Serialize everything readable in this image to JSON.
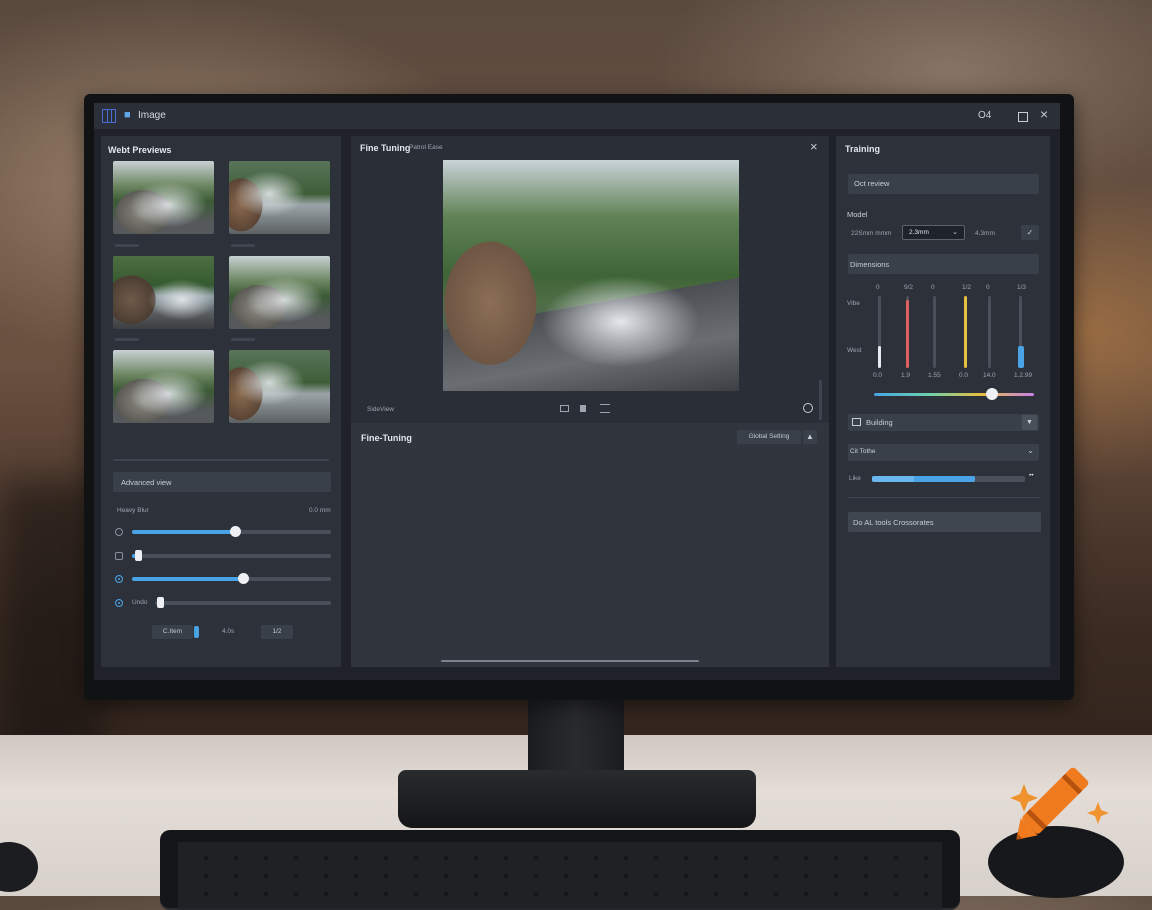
{
  "titlebar": {
    "app_title": "Image",
    "counter": "O4",
    "maximize_icon": "square-icon",
    "close_icon": "x-icon",
    "close_glyph": "×"
  },
  "left_panel": {
    "title": "Webt Previews",
    "section_label": "Advanced view",
    "slider_group_label": "Heavy Blur",
    "slider_group_value": "0.0 mm",
    "sliders": [
      {
        "control": "radio",
        "selected": false,
        "value": 0.52
      },
      {
        "control": "checkbox",
        "checked": false,
        "value": 0.05
      },
      {
        "control": "radio",
        "selected": true,
        "value": 0.56
      },
      {
        "control": "radio",
        "selected": true,
        "label": "Undo",
        "value": 0.15
      }
    ],
    "chips": [
      "C.Item",
      "4.0s",
      "1/2"
    ]
  },
  "center_panel": {
    "title": "Fine Tuning",
    "subtitle": "Patrol Ease",
    "close_glyph": "×",
    "preview_label": "SideView",
    "bottom_title": "Fine-Tuning",
    "bottom_button": "Global Setting"
  },
  "right_panel": {
    "title": "Training",
    "field1": "Oct review",
    "model_label": "Model",
    "model_left": "22Smm mmm",
    "model_select": "2.3mm",
    "model_right": "4.3mm",
    "dimensions_label": "Dimensions",
    "row_label_top": "Vibe",
    "row_label_bottom": "West",
    "vsliders": [
      {
        "top": "0",
        "bottom": "0.0",
        "value": 0.3,
        "color": "#e6e9ee"
      },
      {
        "top": "9/2",
        "bottom": "1.9",
        "value": 0.95,
        "color": "#e06060"
      },
      {
        "top": "0",
        "bottom": "1.55",
        "value": 0.0,
        "color": "#8a919c"
      },
      {
        "top": "1/2",
        "bottom": "0.0",
        "value": 1.0,
        "color": "#e6c040"
      },
      {
        "top": "0",
        "bottom": "14.0",
        "value": 0.0,
        "color": "#8a919c"
      },
      {
        "top": "1/3",
        "bottom": "1.2.99",
        "value": 0.3,
        "color": "#4aa3e6"
      }
    ],
    "hue_slider_value": 0.74,
    "building_label": "Building",
    "select2": "Cit Tothe",
    "like_label": "Like",
    "like_value": 0.67,
    "like_more": "••",
    "bottom_button": "Do AL tools Crossorates"
  }
}
